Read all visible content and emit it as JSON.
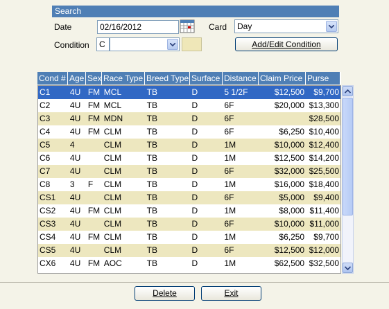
{
  "search": {
    "title": "Search",
    "date_label": "Date",
    "date_value": "02/16/2012",
    "card_label": "Card",
    "card_value": "Day",
    "condition_label": "Condition",
    "condition_code": "C",
    "condition_value": "",
    "add_edit_button": "Add/Edit Condition"
  },
  "grid": {
    "headers": [
      "Cond #",
      "Age",
      "Sex",
      "Race Type",
      "Breed Type",
      "Surface",
      "Distance",
      "Claim Price",
      "Purse"
    ],
    "rows": [
      [
        "C1",
        "4U",
        "FM",
        "MCL",
        "TB",
        "D",
        "5 1/2F",
        "$12,500",
        "$9,700"
      ],
      [
        "C2",
        "4U",
        "FM",
        "MCL",
        "TB",
        "D",
        "6F",
        "$20,000",
        "$13,300"
      ],
      [
        "C3",
        "4U",
        "FM",
        "MDN",
        "TB",
        "D",
        "6F",
        "",
        "$28,500"
      ],
      [
        "C4",
        "4U",
        "FM",
        "CLM",
        "TB",
        "D",
        "6F",
        "$6,250",
        "$10,400"
      ],
      [
        "C5",
        "4",
        "",
        "CLM",
        "TB",
        "D",
        "1M",
        "$10,000",
        "$12,400"
      ],
      [
        "C6",
        "4U",
        "",
        "CLM",
        "TB",
        "D",
        "1M",
        "$12,500",
        "$14,200"
      ],
      [
        "C7",
        "4U",
        "",
        "CLM",
        "TB",
        "D",
        "6F",
        "$32,000",
        "$25,500"
      ],
      [
        "C8",
        "3",
        "F",
        "CLM",
        "TB",
        "D",
        "1M",
        "$16,000",
        "$18,400"
      ],
      [
        "CS1",
        "4U",
        "",
        "CLM",
        "TB",
        "D",
        "6F",
        "$5,000",
        "$9,400"
      ],
      [
        "CS2",
        "4U",
        "FM",
        "CLM",
        "TB",
        "D",
        "1M",
        "$8,000",
        "$11,400"
      ],
      [
        "CS3",
        "4U",
        "",
        "CLM",
        "TB",
        "D",
        "6F",
        "$10,000",
        "$11,000"
      ],
      [
        "CS4",
        "4U",
        "FM",
        "CLM",
        "TB",
        "D",
        "1M",
        "$6,250",
        "$9,700"
      ],
      [
        "CS5",
        "4U",
        "",
        "CLM",
        "TB",
        "D",
        "6F",
        "$12,500",
        "$12,000"
      ],
      [
        "CX6",
        "4U",
        "FM",
        "AOC",
        "TB",
        "D",
        "1M",
        "$62,500",
        "$32,500"
      ]
    ],
    "selected_row": 0
  },
  "footer": {
    "delete_label": "Delete",
    "exit_label": "Exit"
  },
  "colors": {
    "header_blue": "#4f7fb5",
    "row_alt": "#ede7bf",
    "selected": "#3168c4"
  },
  "icons": [
    "calendar-icon",
    "chevron-down-icon",
    "scroll-up-icon",
    "scroll-down-icon"
  ]
}
